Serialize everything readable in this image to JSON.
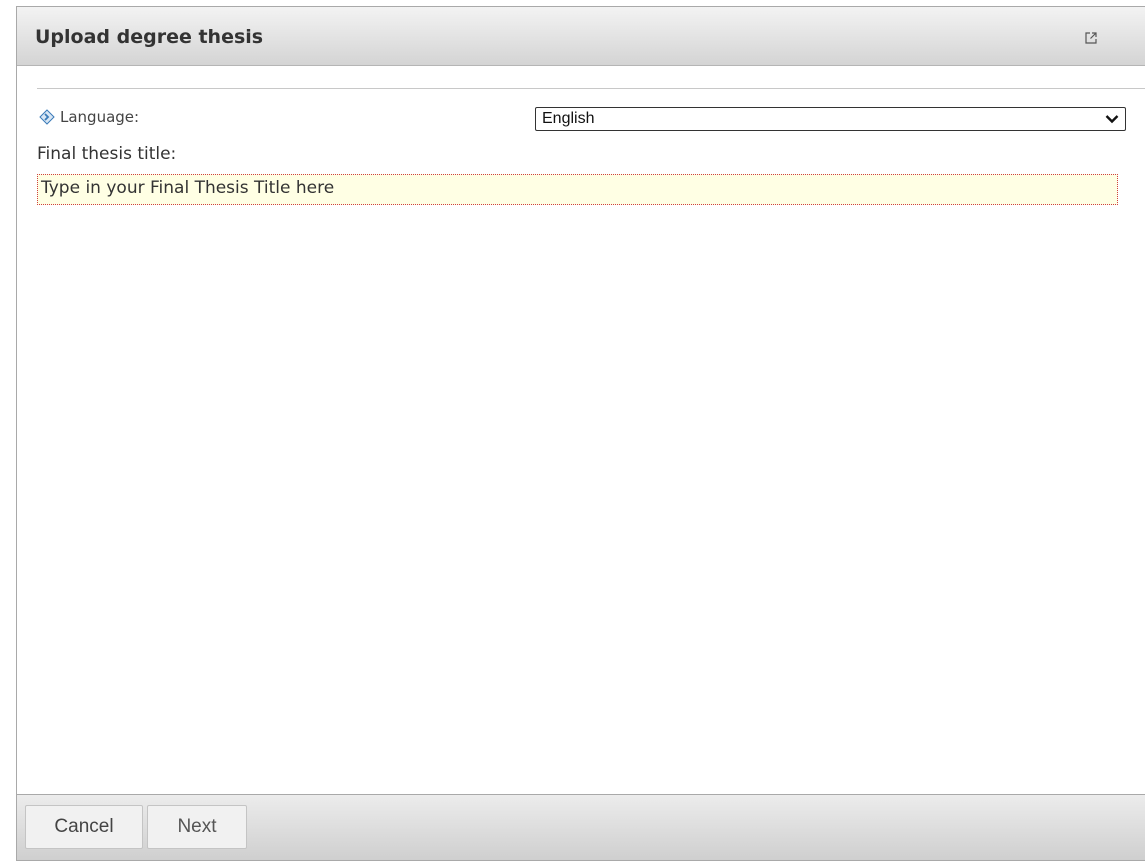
{
  "dialog": {
    "title": "Upload degree thesis",
    "popout_icon": "external-window-icon"
  },
  "form": {
    "language_label": "Language:",
    "language_icon": "diamond-arrow-icon",
    "language_value": "English",
    "thesis_title_label": "Final thesis title:",
    "thesis_title_value": "Type in your Final Thesis Title here"
  },
  "footer": {
    "cancel_label": "Cancel",
    "next_label": "Next"
  },
  "colors": {
    "accent_icon": "#3a7ab8",
    "input_background": "#ffffe4",
    "input_border": "#d04040"
  }
}
